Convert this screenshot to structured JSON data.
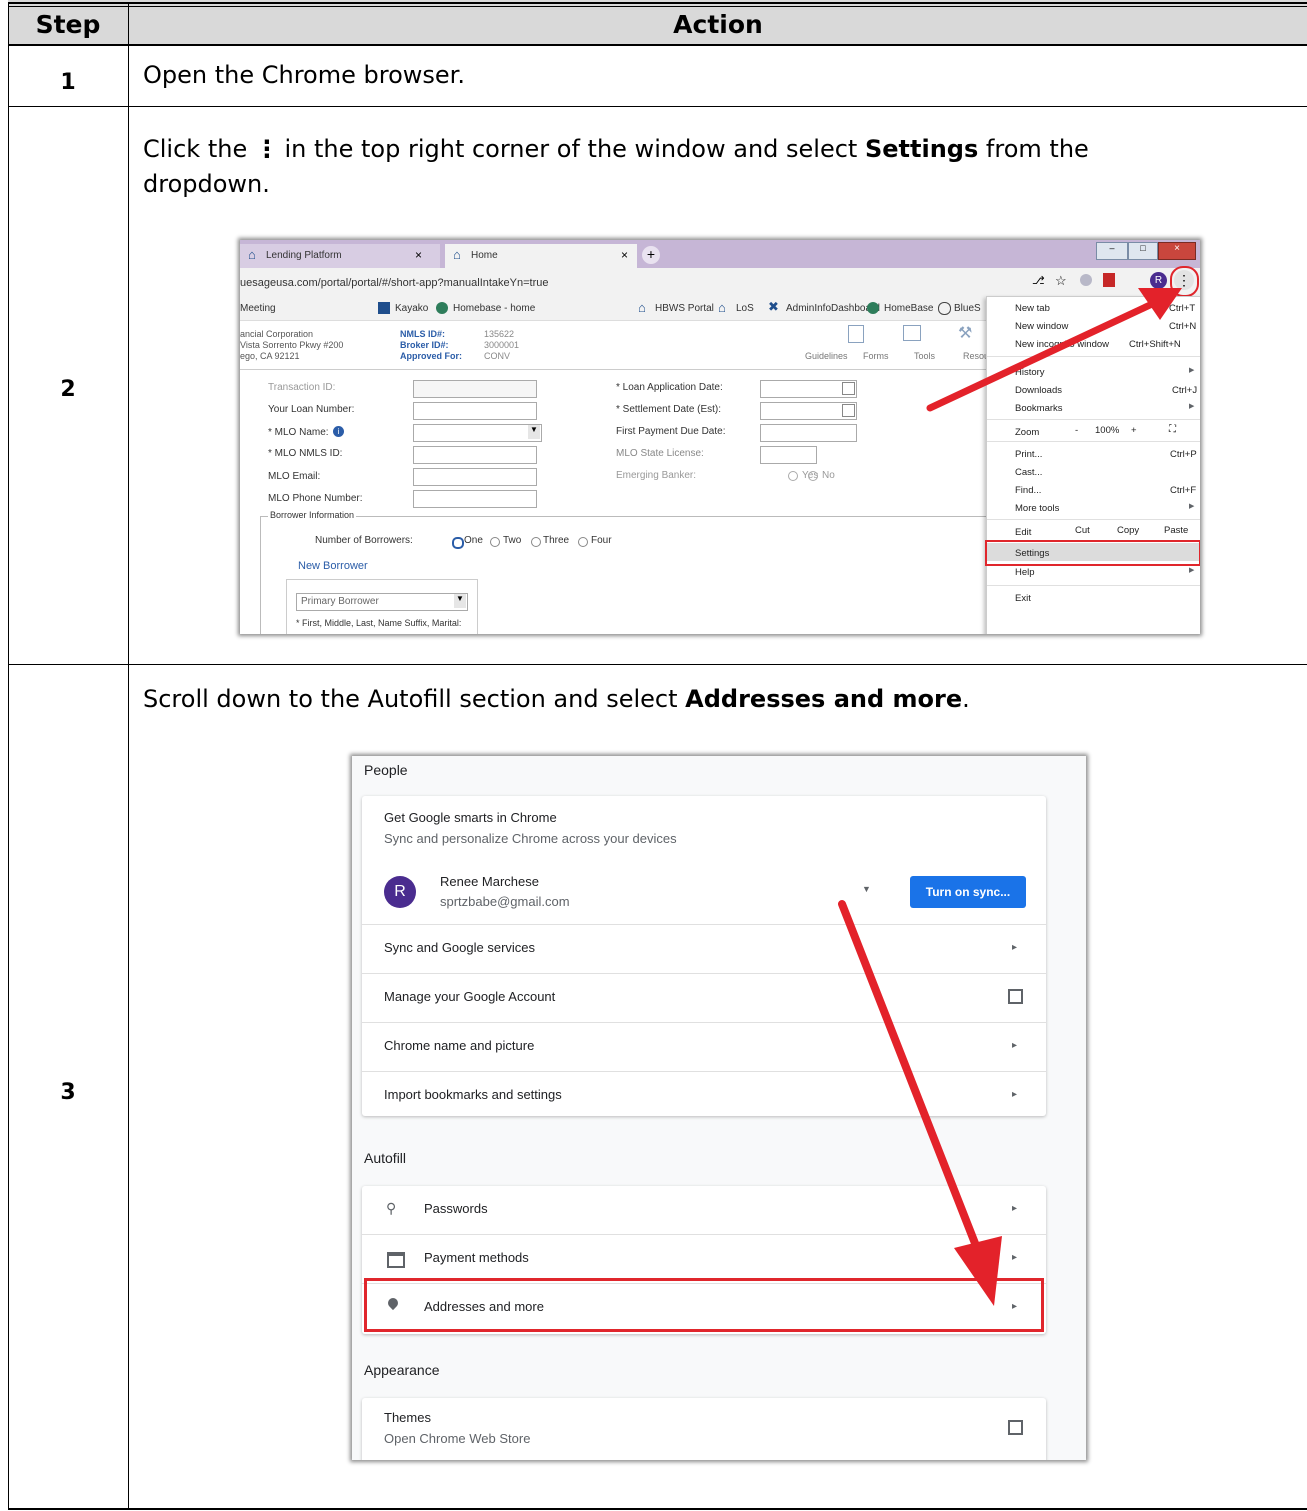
{
  "table": {
    "headers": {
      "step": "Step",
      "action": "Action"
    },
    "rows": [
      {
        "step": "1",
        "text": "Open the Chrome browser."
      },
      {
        "step": "2",
        "text_prefix": "Click the",
        "text_mid": "in the top right corner of the window and select",
        "bold": "Settings",
        "text_suffix": "from the",
        "text_line2": "dropdown."
      },
      {
        "step": "3",
        "text_prefix": "Scroll down to the Autofill section and select",
        "bold": "Addresses and more",
        "text_suffix": "."
      }
    ]
  },
  "browser": {
    "tabs": [
      "Lending Platform",
      "Home"
    ],
    "url": "uesageusa.com/portal/portal/#/short-app?manualIntakeYn=true",
    "bookmarks": [
      "Meeting",
      "Kayako",
      "Homebase - home",
      "HBWS Portal",
      "LoS",
      "AdminInfoDashboard",
      "HomeBase",
      "BlueS"
    ],
    "company": [
      "ancial Corporation",
      "Vista Sorrento Pkwy #200",
      "ego, CA 92121"
    ],
    "ids": {
      "nmls_label": "NMLS ID#:",
      "nmls": "135622",
      "broker_label": "Broker ID#:",
      "broker": "3000001",
      "approved_label": "Approved For:",
      "approved": "CONV"
    },
    "toolbar": [
      "Guidelines",
      "Forms",
      "Tools",
      "Resou"
    ],
    "left_fields": [
      "Transaction ID:",
      "Your Loan Number:",
      "* MLO Name:",
      "* MLO NMLS ID:",
      "MLO Email:",
      "MLO Phone Number:"
    ],
    "right_fields": [
      "* Loan Application Date:",
      "* Settlement Date (Est):",
      "First Payment Due Date:",
      "MLO State License:",
      "Emerging Banker:"
    ],
    "emerging_yes": "Yes",
    "emerging_no": "No",
    "borrower_info": "Borrower Information",
    "num_borrowers_label": "Number of Borrowers:",
    "num_borrowers_options": [
      "One",
      "Two",
      "Three",
      "Four"
    ],
    "new_borrower": "New Borrower",
    "primary_borrower": "Primary Borrower",
    "name_hint": "* First, Middle, Last, Name Suffix, Marital:",
    "avatar_letter": "R",
    "menu": {
      "items": [
        {
          "label": "New tab",
          "shortcut": "Ctrl+T"
        },
        {
          "label": "New window",
          "shortcut": "Ctrl+N"
        },
        {
          "label": "New incognito window",
          "shortcut": "Ctrl+Shift+N"
        },
        {
          "label": "History",
          "shortcut": ""
        },
        {
          "label": "Downloads",
          "shortcut": "Ctrl+J"
        },
        {
          "label": "Bookmarks",
          "shortcut": ""
        },
        {
          "label": "Zoom",
          "shortcut": ""
        },
        {
          "label": "Print...",
          "shortcut": "Ctrl+P"
        },
        {
          "label": "Cast...",
          "shortcut": ""
        },
        {
          "label": "Find...",
          "shortcut": "Ctrl+F"
        },
        {
          "label": "More tools",
          "shortcut": ""
        },
        {
          "label": "Edit",
          "shortcut": ""
        },
        {
          "label": "Settings",
          "shortcut": ""
        },
        {
          "label": "Help",
          "shortcut": ""
        },
        {
          "label": "Exit",
          "shortcut": ""
        }
      ],
      "zoom_minus": "-",
      "zoom_value": "100%",
      "zoom_plus": "+",
      "edit_cut": "Cut",
      "edit_copy": "Copy",
      "edit_paste": "Paste"
    }
  },
  "settings": {
    "people_heading": "People",
    "smarts_title": "Get Google smarts in Chrome",
    "smarts_sub": "Sync and personalize Chrome across your devices",
    "avatar_letter": "R",
    "user_name": "Renee Marchese",
    "user_email": "sprtzbabe@gmail.com",
    "sync_button": "Turn on sync...",
    "people_rows": [
      "Sync and Google services",
      "Manage your Google Account",
      "Chrome name and picture",
      "Import bookmarks and settings"
    ],
    "autofill_heading": "Autofill",
    "autofill_rows": [
      "Passwords",
      "Payment methods",
      "Addresses and more"
    ],
    "appearance_heading": "Appearance",
    "themes_title": "Themes",
    "themes_sub": "Open Chrome Web Store"
  },
  "colors": {
    "header_bg": "#d9d9d9",
    "highlight_red": "#e0262c",
    "arrow_red": "#e3222a",
    "sync_blue": "#1a73e8",
    "avatar_purple": "#4a2c8f"
  }
}
